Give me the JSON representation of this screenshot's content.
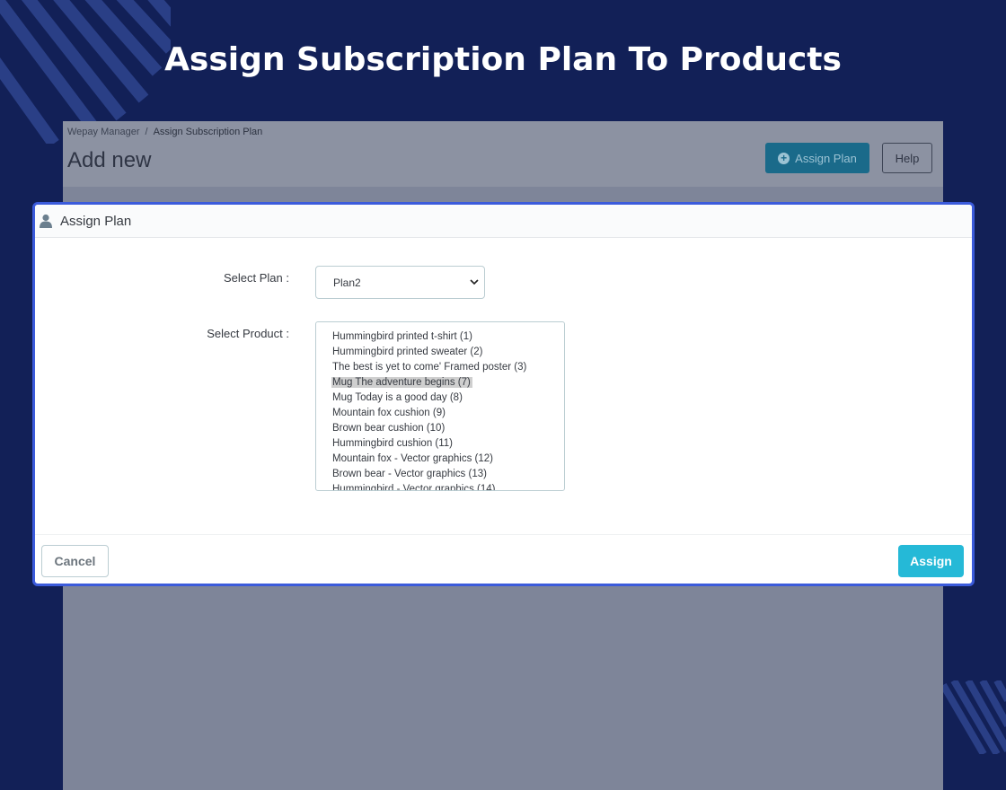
{
  "hero": {
    "title": "Assign Subscription Plan To Products"
  },
  "admin": {
    "breadcrumb": [
      "Wepay Manager",
      "Assign Subscription Plan"
    ],
    "page_title": "Add new",
    "assign_plan_label": "Assign Plan",
    "help_label": "Help"
  },
  "modal": {
    "title": "Assign Plan",
    "select_plan_label": "Select Plan :",
    "select_plan_value": "Plan2",
    "select_product_label": "Select Product :",
    "products": [
      "Hummingbird printed t-shirt (1)",
      "Hummingbird printed sweater (2)",
      "The best is yet to come' Framed poster (3)",
      "Mug The adventure begins (7)",
      "Mug Today is a good day (8)",
      "Mountain fox cushion (9)",
      "Brown bear cushion (10)",
      "Hummingbird cushion (11)",
      "Mountain fox - Vector graphics (12)",
      "Brown bear - Vector graphics (13)",
      "Hummingbird - Vector graphics (14)"
    ],
    "selected_product": "Mug The adventure begins (7)",
    "cancel_label": "Cancel",
    "assign_label": "Assign"
  },
  "colors": {
    "background": "#122057",
    "modal_border": "#3b5bdb",
    "accent": "#25b9d7"
  }
}
